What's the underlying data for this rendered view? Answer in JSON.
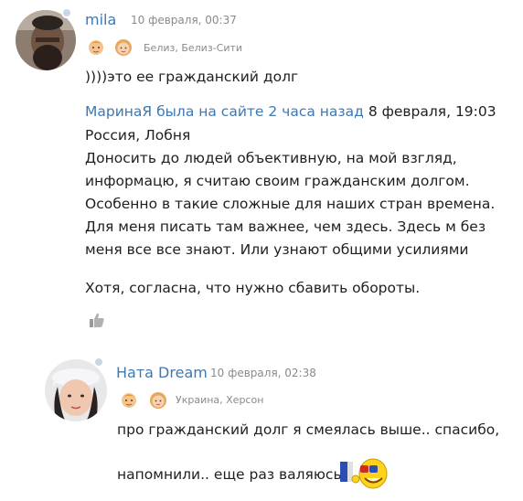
{
  "comment1": {
    "author": "mila",
    "date": "10 февраля, 00:37",
    "location": "Белиз, Белиз-Сити",
    "text": "))))это ее гражданский долг",
    "quote": {
      "author_link": "МаринаЯ была на сайте 2 часа назад",
      "date": "8 февраля, 19:03",
      "location": "Россия, Лобня",
      "lines": [
        "Доносить до людей объективную, на мой взгляд,",
        "информацю, я считаю своим гражданским долгом.",
        "Особенно в такие сложные для наших стран времена.",
        "Для меня писать там важнее, чем здесь. Здесь м без",
        "меня все все знают. Или узнают общими усилиями"
      ],
      "closing": "Хотя, согласна, что нужно сбавить обороты."
    },
    "like_icon": "thumbs-up-icon"
  },
  "comment2": {
    "author": "Ната Dream",
    "date": "10 февраля, 02:38",
    "location": "Украина, Херсон",
    "text1": "про гражданский долг я смеялась выше.. спасибо,",
    "text2": "напомнили.. еще раз валяюсь"
  },
  "colors": {
    "link": "#3e78b3",
    "meta": "#8a8a8a",
    "text": "#1f1f1f"
  }
}
